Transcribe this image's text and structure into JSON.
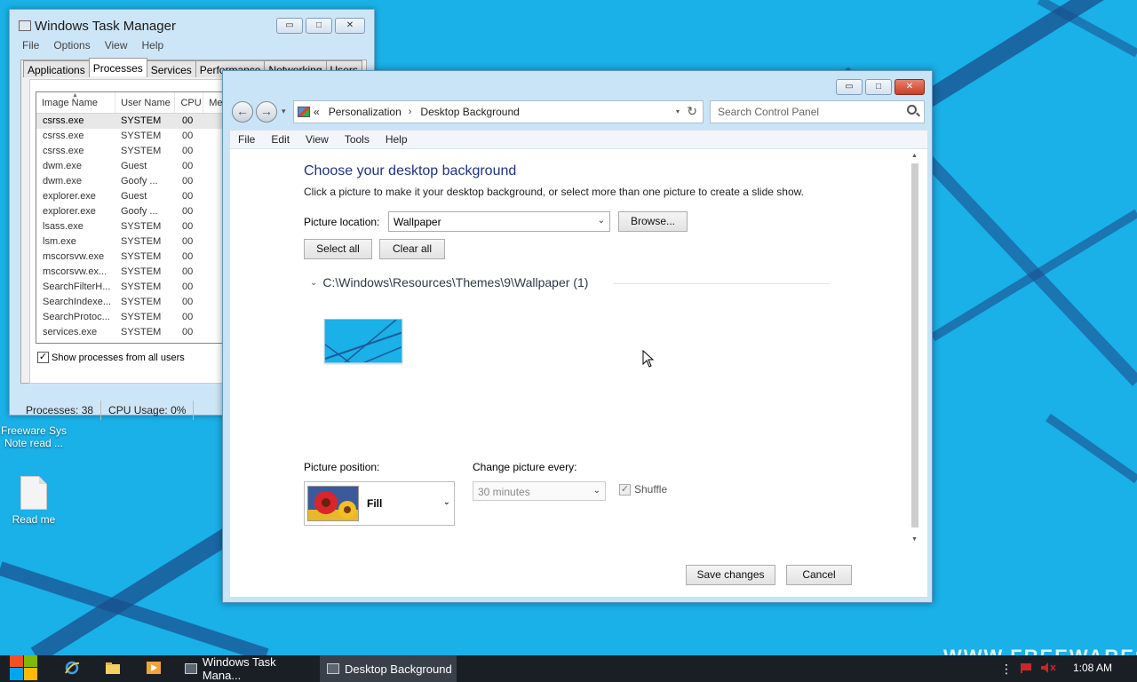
{
  "desktop": {
    "icons": [
      {
        "label_line1": "Freeware Sys",
        "label_line2": "Note read ..."
      },
      {
        "label": "Read me"
      }
    ],
    "watermark": "WWW.FREEWARESYS",
    "background_color": "#1ab0e8"
  },
  "task_manager": {
    "title": "Windows Task Manager",
    "menu": [
      "File",
      "Options",
      "View",
      "Help"
    ],
    "tabs": [
      "Applications",
      "Processes",
      "Services",
      "Performance",
      "Networking",
      "Users"
    ],
    "active_tab": "Processes",
    "columns": [
      "Image Name",
      "User Name",
      "CPU",
      "Me"
    ],
    "rows": [
      [
        "csrss.exe",
        "SYSTEM",
        "00"
      ],
      [
        "csrss.exe",
        "SYSTEM",
        "00"
      ],
      [
        "csrss.exe",
        "SYSTEM",
        "00"
      ],
      [
        "dwm.exe",
        "Guest",
        "00"
      ],
      [
        "dwm.exe",
        "Goofy ...",
        "00"
      ],
      [
        "explorer.exe",
        "Guest",
        "00"
      ],
      [
        "explorer.exe",
        "Goofy ...",
        "00"
      ],
      [
        "lsass.exe",
        "SYSTEM",
        "00"
      ],
      [
        "lsm.exe",
        "SYSTEM",
        "00"
      ],
      [
        "mscorsvw.exe",
        "SYSTEM",
        "00"
      ],
      [
        "mscorsvw.ex...",
        "SYSTEM",
        "00"
      ],
      [
        "SearchFilterH...",
        "SYSTEM",
        "00"
      ],
      [
        "SearchIndexe...",
        "SYSTEM",
        "00"
      ],
      [
        "SearchProtoc...",
        "SYSTEM",
        "00"
      ],
      [
        "services.exe",
        "SYSTEM",
        "00"
      ]
    ],
    "show_all_label": "Show processes from all users",
    "show_all_checked": "✓",
    "status_processes": "Processes: 38",
    "status_cpu": "CPU Usage: 0%",
    "caption_buttons": {
      "minimize": "▭",
      "maximize": "□",
      "close": "✕"
    }
  },
  "control_panel": {
    "window_title": "Desktop Background",
    "nav": {
      "back": "←",
      "forward": "→",
      "history": "▾"
    },
    "address": {
      "prefix": "«",
      "crumb1": "Personalization",
      "separator": "›",
      "crumb2": "Desktop Background",
      "dropdown": "▾",
      "refresh": "↻"
    },
    "search_placeholder": "Search Control Panel",
    "menu": [
      "File",
      "Edit",
      "View",
      "Tools",
      "Help"
    ],
    "heading": "Choose your desktop background",
    "subtext": "Click a picture to make it your desktop background, or select more than one picture to create a slide show.",
    "picture_location_label": "Picture location:",
    "picture_location_value": "Wallpaper",
    "browse_label": "Browse...",
    "select_all_label": "Select all",
    "clear_all_label": "Clear all",
    "group_toggle": "⌄",
    "group_path": "C:\\Windows\\Resources\\Themes\\9\\Wallpaper (1)",
    "picture_position_label": "Picture position:",
    "picture_position_value": "Fill",
    "change_every_label": "Change picture every:",
    "change_every_value": "30 minutes",
    "shuffle_label": "Shuffle",
    "shuffle_checked": "✓",
    "save_label": "Save changes",
    "cancel_label": "Cancel",
    "caption_buttons": {
      "minimize": "▭",
      "maximize": "□",
      "close": "✕"
    },
    "accent": "#1e3287"
  },
  "taskbar": {
    "tasks": [
      "Windows Task Mana...",
      "Desktop Background"
    ],
    "active_task": "Desktop Background",
    "clock": "1:08 AM",
    "start_colors": [
      "#f25022",
      "#7fba00",
      "#00a4ef",
      "#ffb900"
    ]
  }
}
